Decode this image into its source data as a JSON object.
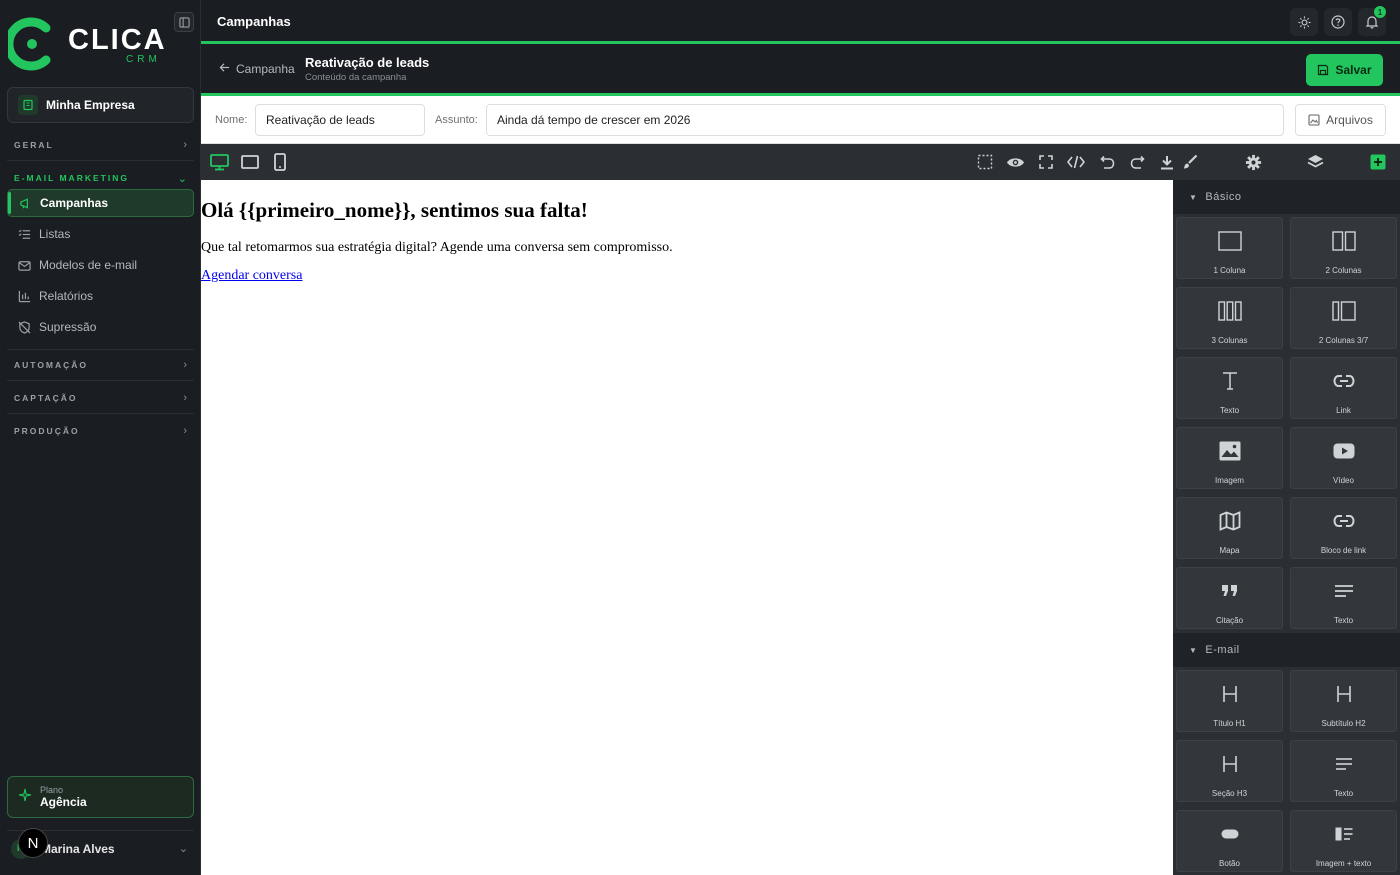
{
  "brand": {
    "name": "CLICA",
    "sub": "CRM",
    "accent": "#22c55e"
  },
  "sidebar": {
    "company": "Minha Empresa",
    "sections": {
      "geral": "GERAL",
      "email": "E-MAIL MARKETING",
      "automacao": "AUTOMAÇÃO",
      "captacao": "CAPTAÇÃO",
      "producao": "PRODUÇÃO"
    },
    "items": [
      {
        "label": "Campanhas",
        "icon": "megaphone-icon"
      },
      {
        "label": "Listas",
        "icon": "list-icon"
      },
      {
        "label": "Modelos de e-mail",
        "icon": "mail-icon"
      },
      {
        "label": "Relatórios",
        "icon": "chart-icon"
      },
      {
        "label": "Supressão",
        "icon": "shield-off-icon"
      }
    ],
    "plan": {
      "label": "Plano",
      "value": "Agência"
    },
    "user": {
      "initial": "M",
      "name": "Marina Alves"
    },
    "next_badge": "N"
  },
  "header": {
    "title": "Campanhas",
    "notif_count": "1"
  },
  "subheader": {
    "back_label": "Campanha",
    "title": "Reativação de leads",
    "subtitle": "Conteúdo da campanha",
    "save_label": "Salvar"
  },
  "fields": {
    "name_label": "Nome:",
    "name_value": "Reativação de leads",
    "subject_label": "Assunto:",
    "subject_value": "Ainda dá tempo de crescer em 2026",
    "files_label": "Arquivos"
  },
  "canvas": {
    "heading": "Olá {{primeiro_nome}}, sentimos sua falta!",
    "body": "Que tal retomarmos sua estratégia digital? Agende uma conversa sem compromisso.",
    "link": "Agendar conversa"
  },
  "blocks": {
    "basic_label": "Básico",
    "basic": [
      "1 Coluna",
      "2 Colunas",
      "3 Colunas",
      "2 Colunas 3/7",
      "Texto",
      "Link",
      "Imagem",
      "Vídeo",
      "Mapa",
      "Bloco de link",
      "Citação",
      "Texto"
    ],
    "email_label": "E-mail",
    "email": [
      "Título H1",
      "Subtítulo H2",
      "Seção H3",
      "Texto",
      "Botão",
      "Imagem + texto"
    ]
  }
}
